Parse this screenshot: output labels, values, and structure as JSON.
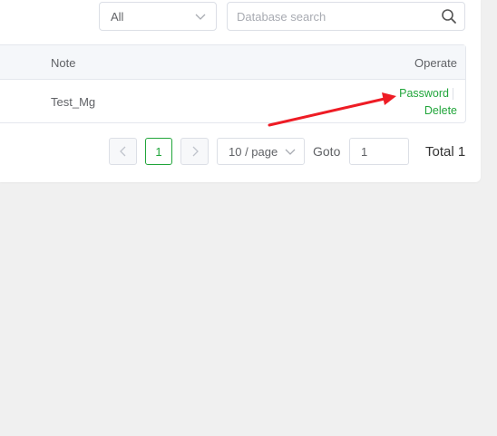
{
  "filter": {
    "type_select_value": "All",
    "search_placeholder": "Database search"
  },
  "table": {
    "columns": {
      "note": "Note",
      "operate": "Operate"
    },
    "rows": [
      {
        "note": "Test_Mg",
        "actions": {
          "password": "Password",
          "delete": "Delete"
        }
      }
    ]
  },
  "pagination": {
    "current_page": "1",
    "page_size": "10 / page",
    "goto_label": "Goto",
    "goto_value": "1",
    "total": "Total 1"
  },
  "colors": {
    "accent": "#20a53a",
    "annotation_arrow": "#ee1c25"
  },
  "icons": {
    "select_chevron": "chevron-down-icon",
    "search": "search-icon",
    "prev": "chevron-left-icon",
    "next": "chevron-right-icon"
  }
}
